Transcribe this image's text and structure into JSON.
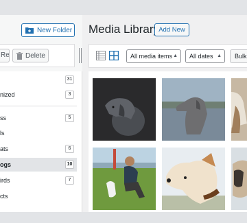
{
  "sidebar": {
    "new_folder_label": "New Folder",
    "rename_label": "Rename",
    "delete_label": "Delete",
    "folders": [
      {
        "label": "",
        "count": "31"
      },
      {
        "label": "nized",
        "count": "3"
      },
      {
        "label": "ss",
        "count": "5"
      },
      {
        "label": "ls",
        "count": ""
      },
      {
        "label": "ats",
        "count": "6"
      },
      {
        "label": "ogs",
        "count": "10"
      },
      {
        "label": "irds",
        "count": "7"
      },
      {
        "label": "cts",
        "count": ""
      }
    ]
  },
  "main": {
    "title": "Media Library",
    "add_new_label": "Add New",
    "filter_types": "All media items",
    "filter_dates": "All dates",
    "bulk_label": "Bulk"
  },
  "media": [
    {
      "name": "black-dog-dark-background"
    },
    {
      "name": "grey-dog-lake"
    },
    {
      "name": "person-holding-dog"
    },
    {
      "name": "man-feeding-white-dog"
    },
    {
      "name": "white-tan-dog-closeup"
    },
    {
      "name": "pug-partial"
    }
  ],
  "colors": {
    "accent": "#2271b1",
    "selected_row": "#e2e4e7"
  }
}
